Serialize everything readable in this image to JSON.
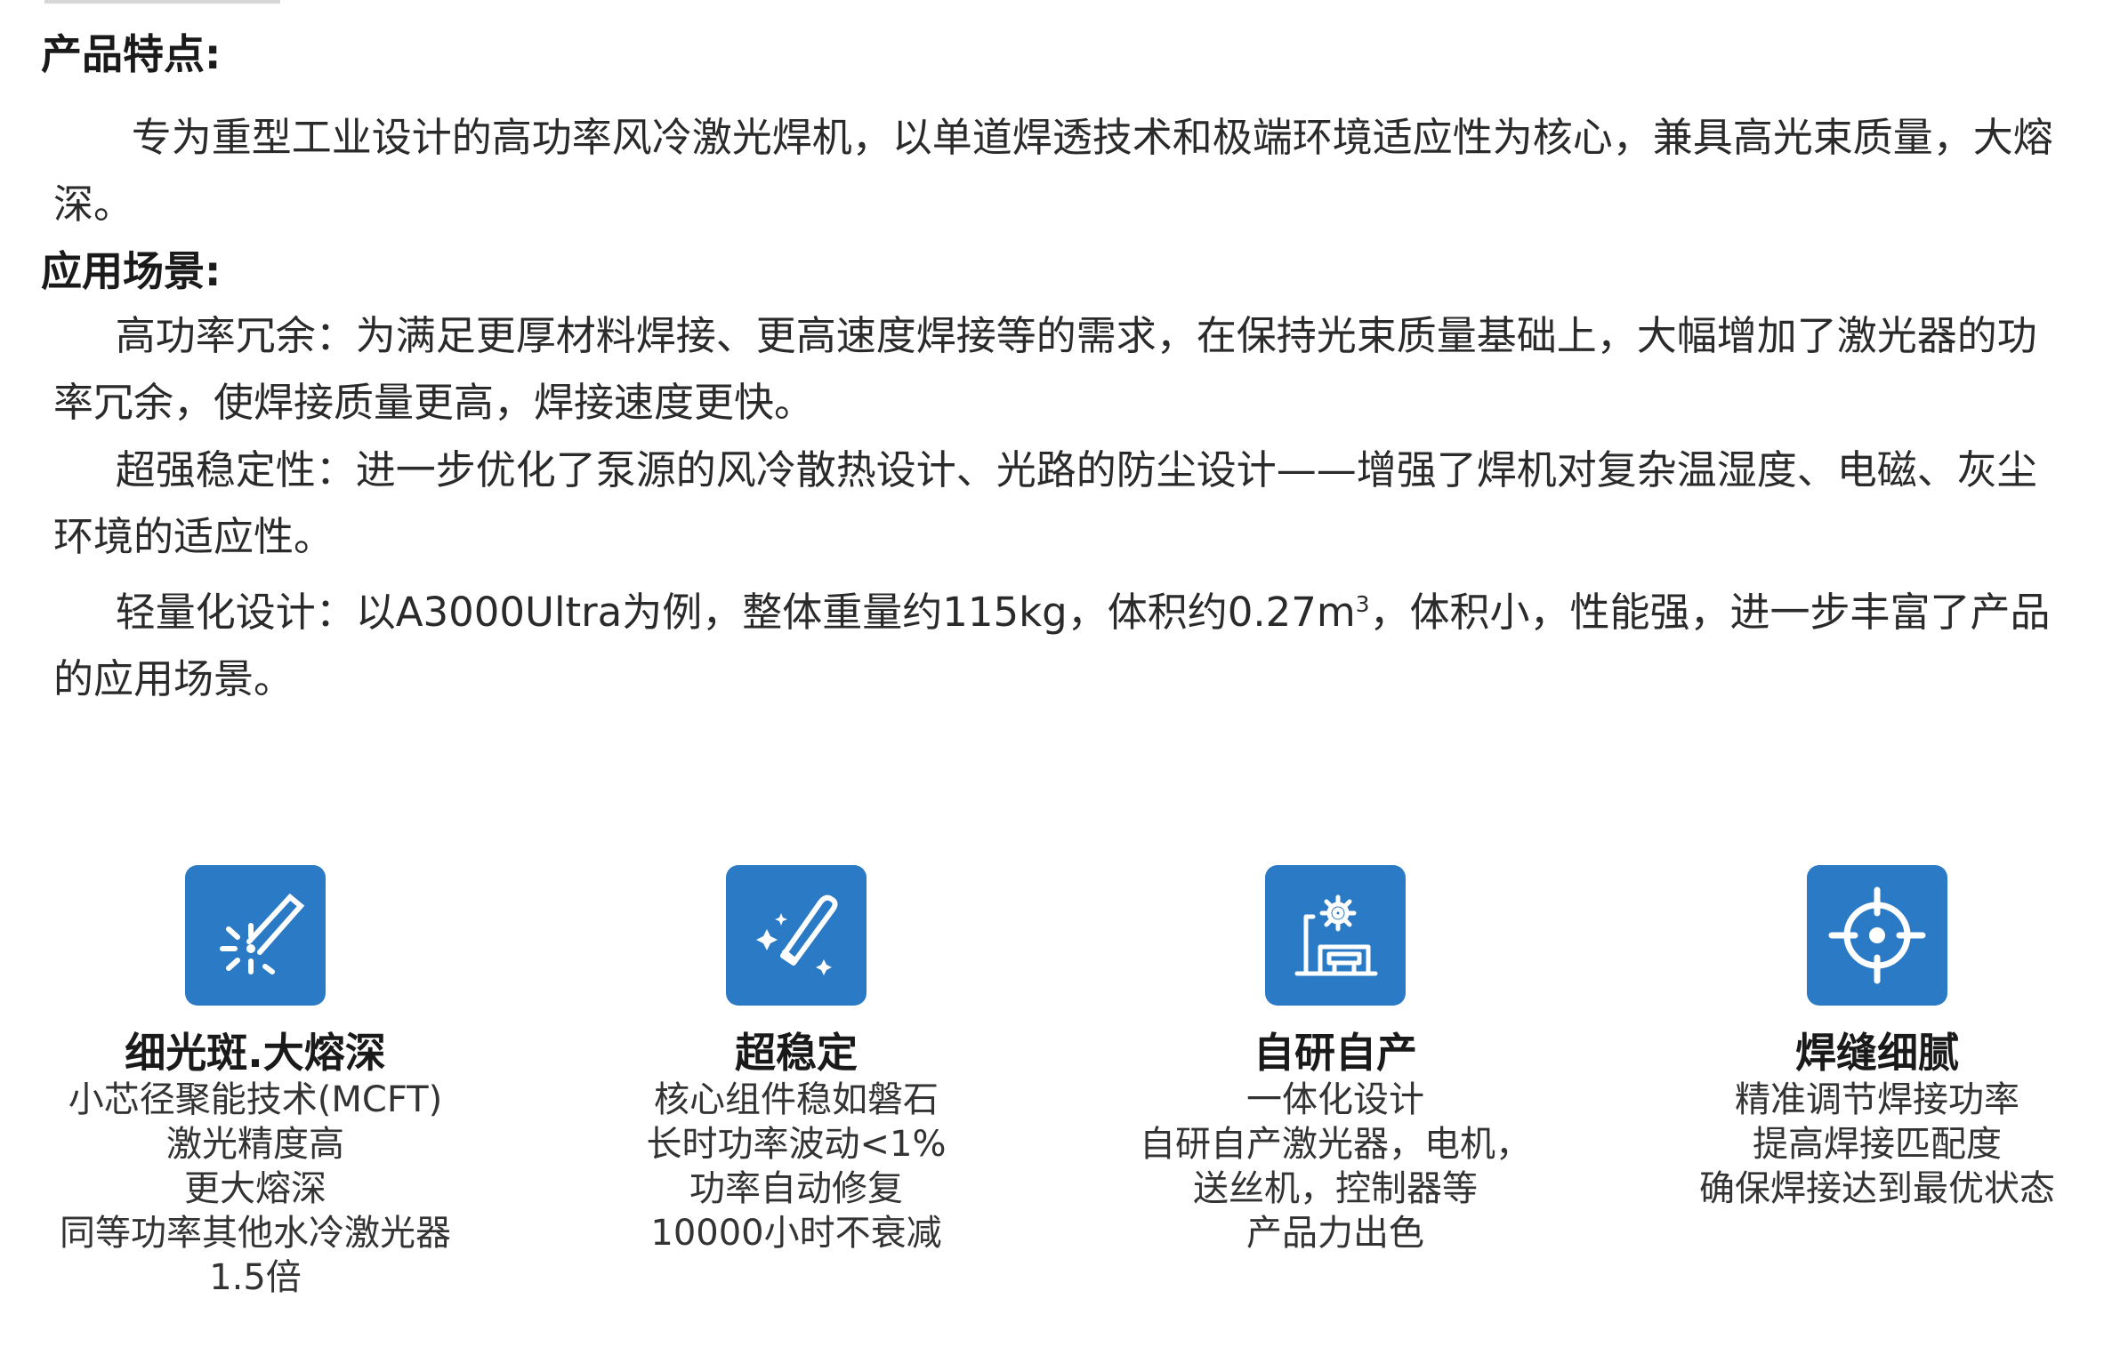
{
  "features": {
    "heading": "产品特点:",
    "text": "专为重型工业设计的高功率风冷激光焊机，以单道焊透技术和极端环境适应性为核心，兼具高光束质量，大熔深。"
  },
  "scenes": {
    "heading": "应用场景:",
    "items": [
      {
        "text": "高功率冗余：为满足更厚材料焊接、更高速度焊接等的需求，在保持光束质量基础上，大幅增加了激光器的功率冗余，使焊接质量更高，焊接速度更快。"
      },
      {
        "text": "超强稳定性：进一步优化了泵源的风冷散热设计、光路的防尘设计——增强了焊机对复杂温湿度、电磁、灰尘环境的适应性。"
      },
      {
        "text_before": "轻量化设计：以A3000Ultra为例，整体重量约115kg，体积约0.27m",
        "superscript": "3",
        "text_after": "，体积小，性能强，进一步丰富了产品的应用场景。"
      }
    ]
  },
  "cards": [
    {
      "icon": "laser-spot-icon",
      "title": "细光斑.大熔深",
      "lines": [
        "小芯径聚能技术(MCFT)",
        "激光精度高",
        "更大熔深",
        "同等功率其他水冷激光器",
        "1.5倍"
      ]
    },
    {
      "icon": "laser-wand-icon",
      "title": "超稳定",
      "lines": [
        "核心组件稳如磐石",
        "长时功率波动<1%",
        "功率自动修复",
        "10000小时不衰减"
      ]
    },
    {
      "icon": "factory-gear-icon",
      "title": "自研自产",
      "lines": [
        "一体化设计",
        "自研自产激光器，电机，",
        "送丝机，控制器等",
        "产品力出色"
      ]
    },
    {
      "icon": "crosshair-target-icon",
      "title": "焊缝细腻",
      "lines": [
        "精准调节焊接功率",
        "提高焊接匹配度",
        "确保焊接达到最优状态"
      ]
    }
  ],
  "colors": {
    "accent": "#2a7ac6",
    "text": "#2a2a2a",
    "heading": "#1a1a1a"
  }
}
